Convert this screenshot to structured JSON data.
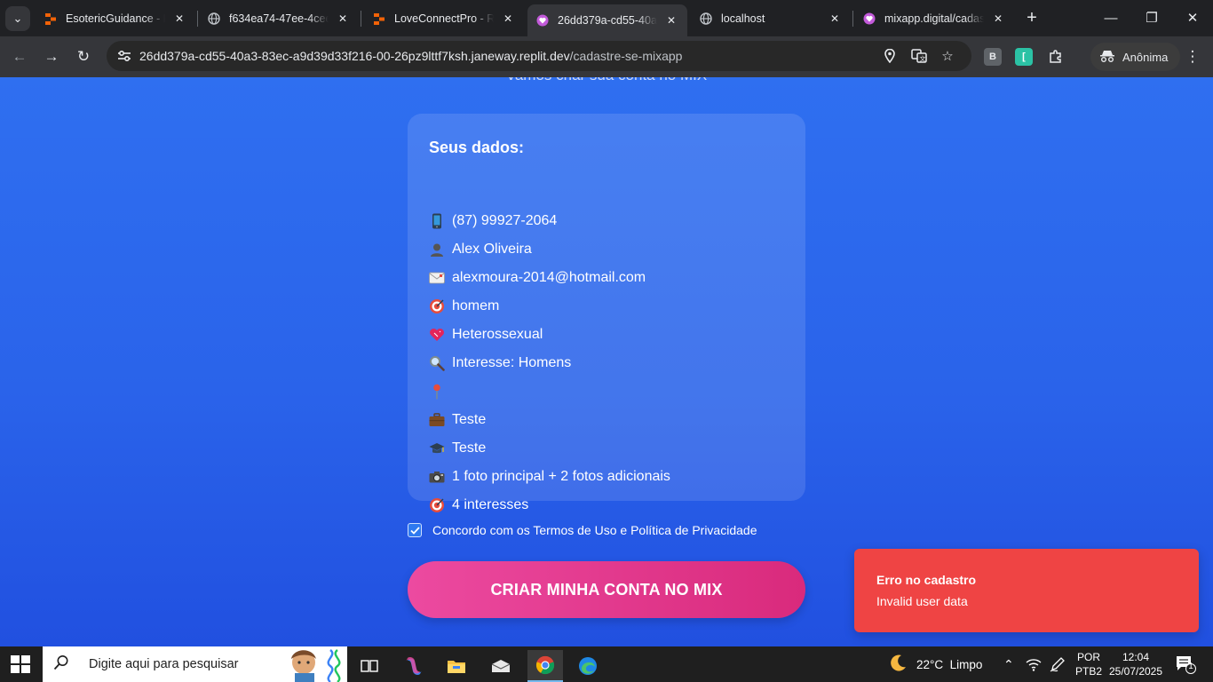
{
  "browser": {
    "tabs": [
      {
        "title": "EsotericGuidance - Re",
        "favicon": "replit-icon",
        "active": false
      },
      {
        "title": "f634ea74-47ee-4cee-",
        "favicon": "globe-icon",
        "active": false
      },
      {
        "title": "LoveConnectPro - Rep",
        "favicon": "replit-icon",
        "active": false
      },
      {
        "title": "26dd379a-cd55-40a3-",
        "favicon": "heart-icon",
        "active": true
      },
      {
        "title": "localhost",
        "favicon": "globe-icon",
        "active": false
      },
      {
        "title": "mixapp.digital/cadast",
        "favicon": "heart-icon",
        "active": false
      }
    ],
    "url_host": "26dd379a-cd55-40a3-83ec-a9d39d33f216-00-26pz9lttf7ksh.janeway.replit.dev",
    "url_path": "/cadastre-se-mixapp",
    "profile_label": "Anônima",
    "extensions": [
      "B",
      "["
    ]
  },
  "page": {
    "cut_heading": "Vamos criar sua conta no MIX",
    "summary": {
      "title": "Seus dados:",
      "items": [
        {
          "icon": "phone-icon",
          "text": "(87) 99927-2064"
        },
        {
          "icon": "person-icon",
          "text": "Alex Oliveira"
        },
        {
          "icon": "envelope-icon",
          "text": "alexmoura-2014@hotmail.com"
        },
        {
          "icon": "target-icon",
          "text": "homem"
        },
        {
          "icon": "heart-icon",
          "text": "Heterossexual"
        },
        {
          "icon": "magnifier-icon",
          "text": "Interesse: Homens"
        },
        {
          "icon": "pin-icon",
          "text": ""
        },
        {
          "icon": "briefcase-icon",
          "text": "Teste"
        },
        {
          "icon": "graduation-cap-icon",
          "text": "Teste"
        },
        {
          "icon": "camera-icon",
          "text": "1 foto principal + 2 fotos adicionais"
        },
        {
          "icon": "target-icon",
          "text": "4 interesses"
        }
      ]
    },
    "terms_label": "Concordo com os Termos de Uso e Política de Privacidade",
    "terms_checked": true,
    "submit_label": "CRIAR MINHA CONTA NO MIX",
    "toast": {
      "title": "Erro no cadastro",
      "message": "Invalid user data",
      "color": "#ef4444"
    }
  },
  "taskbar": {
    "search_placeholder": "Digite aqui para pesquisar",
    "weather": "22°C  Limpo",
    "lang_top": "POR",
    "lang_bottom": "PTB2",
    "time": "12:04",
    "date": "25/07/2025",
    "notification_count": "1"
  },
  "colors": {
    "accent_blue": "#2f6ff0",
    "cta_pink": "#ec4aa0",
    "error_red": "#ef4444"
  }
}
